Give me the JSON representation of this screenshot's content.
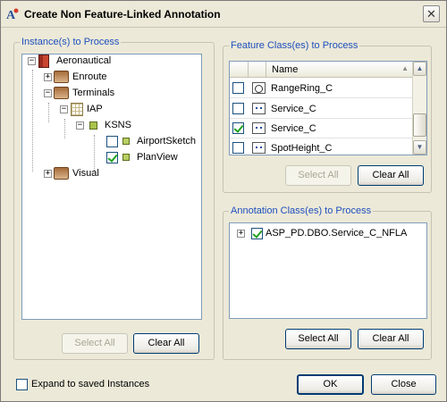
{
  "window": {
    "title": "Create Non Feature-Linked Annotation",
    "close_glyph": "✕",
    "app_icon": "annotation-app-icon"
  },
  "instances": {
    "legend": "Instance(s) to Process",
    "tree": [
      {
        "label": "Aeronautical",
        "icon": "book-icon",
        "expander": "−"
      },
      {
        "label": "Enroute",
        "icon": "stack-icon",
        "expander": "+"
      },
      {
        "label": "Terminals",
        "icon": "stack-icon",
        "expander": "−"
      },
      {
        "label": "IAP",
        "icon": "grid-icon",
        "expander": "−"
      },
      {
        "label": "KSNS",
        "icon": "square-icon",
        "expander": "−"
      },
      {
        "label": "AirportSketch",
        "icon": "small-square-icon",
        "checked": false
      },
      {
        "label": "PlanView",
        "icon": "small-square-icon",
        "checked": true
      },
      {
        "label": "Visual",
        "icon": "stack-icon",
        "expander": "+"
      }
    ],
    "select_all": "Select All",
    "clear_all": "Clear All"
  },
  "feature_classes": {
    "legend": "Feature Class(es) to Process",
    "column_name": "Name",
    "sort_glyph": "▲",
    "rows": [
      {
        "name": "RangeRing_C",
        "checked": false,
        "symbol": "range-ring-icon"
      },
      {
        "name": "Service_C",
        "checked": false,
        "symbol": "point-symbol-icon"
      },
      {
        "name": "Service_C",
        "checked": true,
        "symbol": "point-symbol-icon"
      },
      {
        "name": "SpotHeight_C",
        "checked": false,
        "symbol": "point-symbol-icon"
      }
    ],
    "select_all": "Select All",
    "clear_all": "Clear All"
  },
  "annotation_classes": {
    "legend": "Annotation Class(es) to Process",
    "items": [
      {
        "label": "ASP_PD.DBO.Service_C_NFLA",
        "checked": true,
        "expander": "+"
      }
    ],
    "select_all": "Select All",
    "clear_all": "Clear All"
  },
  "footer": {
    "expand_label": "Expand to saved Instances",
    "expand_checked": false,
    "ok": "OK",
    "close": "Close"
  },
  "colors": {
    "legend": "#1e4fbd",
    "dialog_bg": "#ece9d8",
    "check": "#21a121"
  }
}
